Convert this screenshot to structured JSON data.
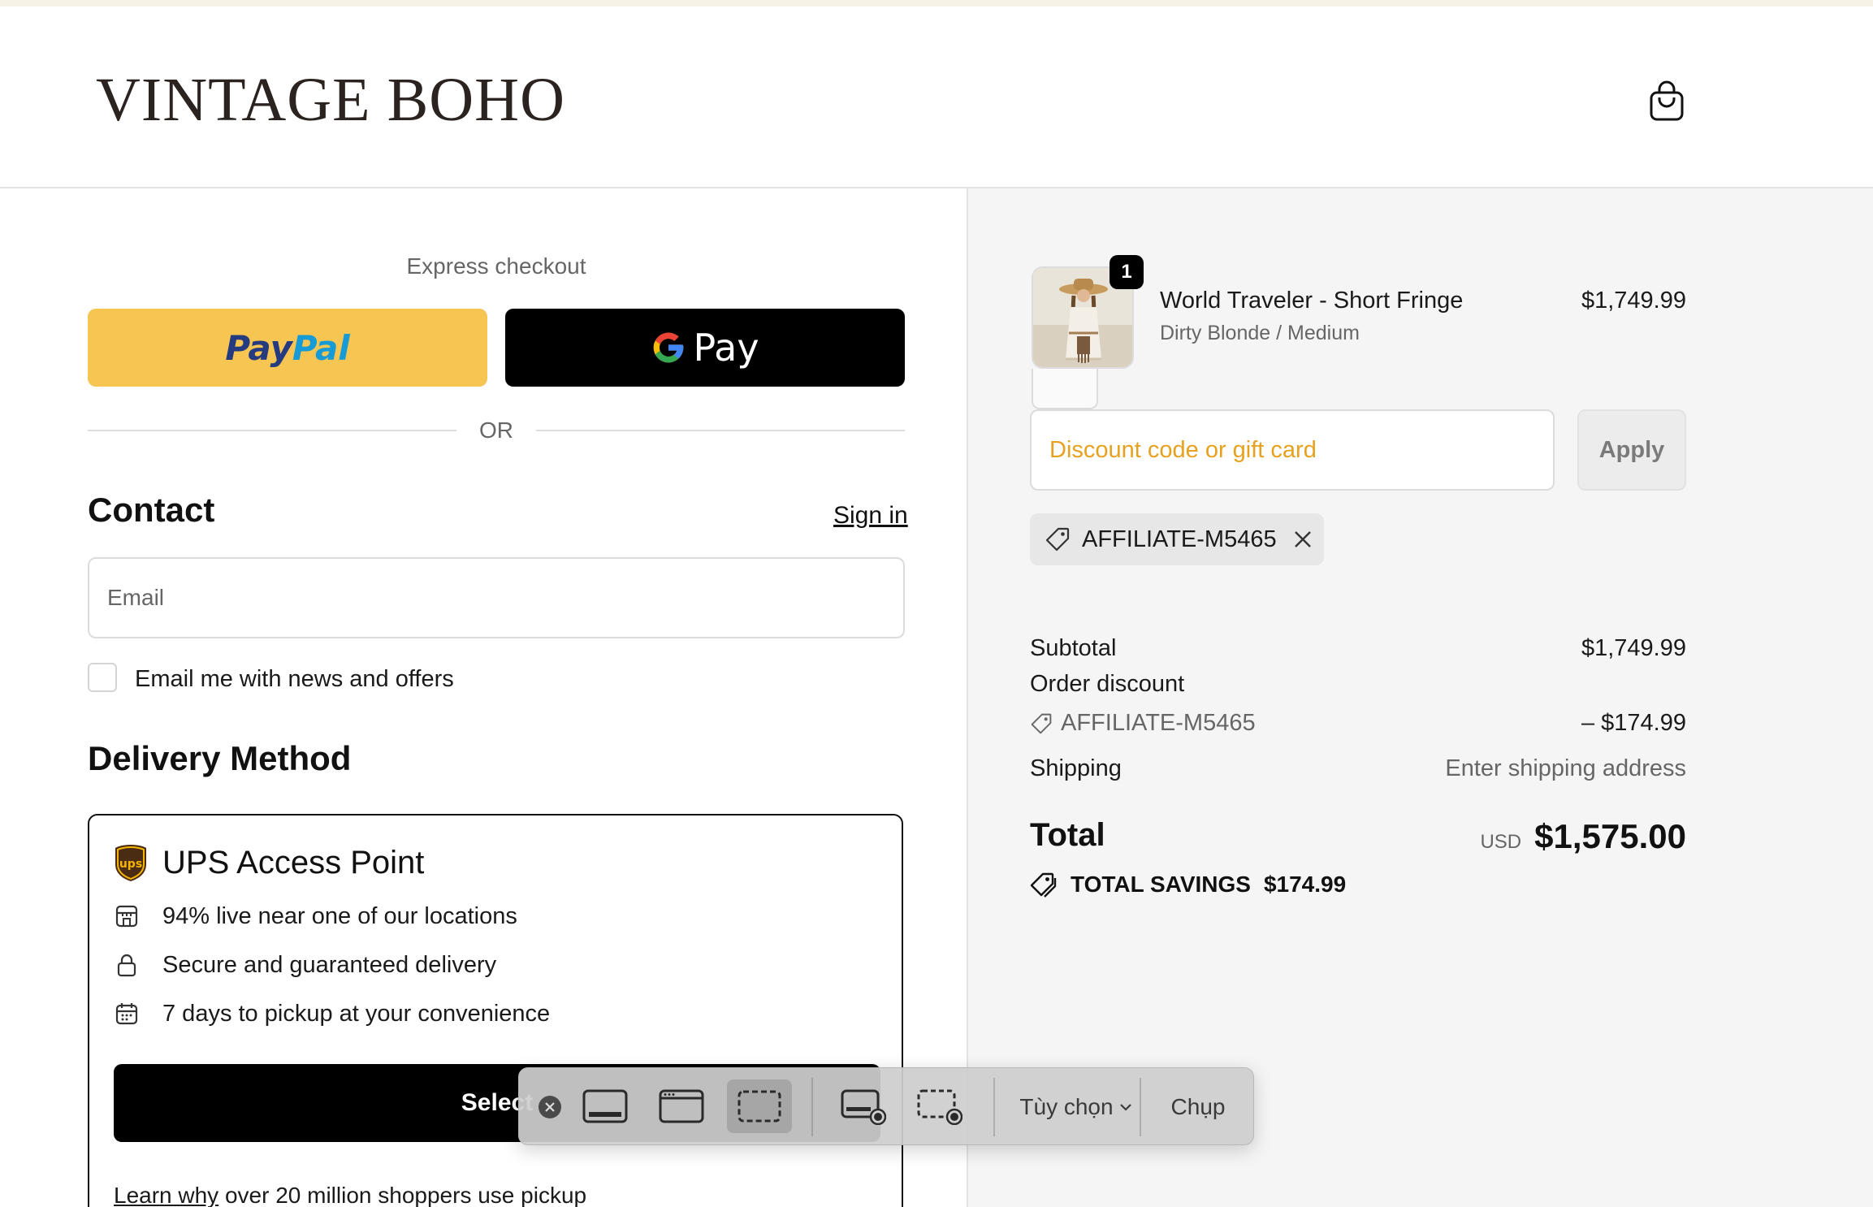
{
  "header": {
    "logo_text": "VINTAGE BOHO",
    "cart_icon": "shopping-bag-icon"
  },
  "express": {
    "label": "Express checkout",
    "paypal_part1": "Pay",
    "paypal_part2": "Pal",
    "gpay_label": "Pay",
    "divider": "OR",
    "colors": {
      "paypal": "#f7c552",
      "gpay": "#000000"
    }
  },
  "contact": {
    "title": "Contact",
    "sign_in": "Sign in",
    "email_placeholder": "Email",
    "newsletter_label": "Email me with news and offers"
  },
  "delivery": {
    "title": "Delivery Method",
    "option_title": "UPS Access Point",
    "features": [
      {
        "icon": "store-icon",
        "text": "94% live near one of our locations"
      },
      {
        "icon": "lock-icon",
        "text": "Secure and guaranteed delivery"
      },
      {
        "icon": "calendar-icon",
        "text": "7 days to pickup at your convenience"
      }
    ],
    "select_label": "Select",
    "learn_link": "Learn why",
    "learn_rest": "over 20 million shoppers use pickup"
  },
  "summary": {
    "product": {
      "quantity": "1",
      "name": "World Traveler - Short Fringe",
      "variant": "Dirty Blonde / Medium",
      "price": "$1,749.99"
    },
    "discount_placeholder": "Discount code or gift card",
    "apply_label": "Apply",
    "applied_code": "AFFILIATE-M5465",
    "subtotal_label": "Subtotal",
    "subtotal_value": "$1,749.99",
    "order_discount_label": "Order discount",
    "discount_code": "AFFILIATE-M5465",
    "discount_value": "– $174.99",
    "shipping_label": "Shipping",
    "shipping_value": "Enter shipping address",
    "total_label": "Total",
    "currency": "USD",
    "total_value": "$1,575.00",
    "savings_label": "TOTAL SAVINGS",
    "savings_value": "$174.99"
  },
  "screenshot_toolbar": {
    "options_label": "Tùy chọn",
    "capture_label": "Chụp"
  }
}
